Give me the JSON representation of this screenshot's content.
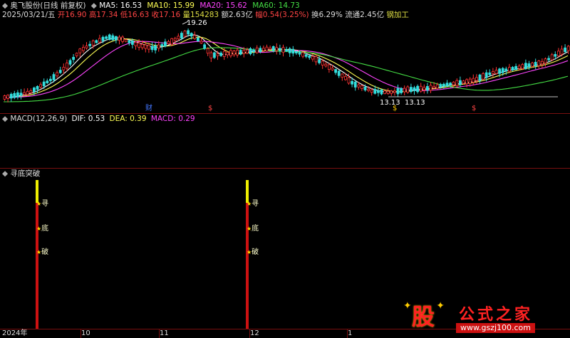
{
  "header": {
    "stock_name": "奥飞股份(日线 前复权)",
    "ma_labels": [
      {
        "label": "MA5: 16.53",
        "color": "#ffffff"
      },
      {
        "label": "MA10: 15.99",
        "color": "#ffff55"
      },
      {
        "label": "MA20: 15.62",
        "color": "#ff44ff"
      },
      {
        "label": "MA60: 14.73",
        "color": "#44dd44"
      }
    ]
  },
  "quote": {
    "date": "2025/03/21/五",
    "items": [
      {
        "label": "开16.90",
        "color": "#ff4444"
      },
      {
        "label": "高17.34",
        "color": "#ff4444"
      },
      {
        "label": "低16.63",
        "color": "#ff4444"
      },
      {
        "label": "收17.16",
        "color": "#ff4444"
      },
      {
        "label": "量154283",
        "color": "#dddd44"
      },
      {
        "label": "额2.63亿",
        "color": "#dddddd"
      },
      {
        "label": "幅0.54(3.25%)",
        "color": "#ff4444"
      },
      {
        "label": "换6.29%",
        "color": "#dddddd"
      },
      {
        "label": "流通2.45亿",
        "color": "#dddddd"
      },
      {
        "label": "钢加工",
        "color": "#dddd44"
      }
    ]
  },
  "price_annotations": {
    "high": "19.26",
    "low_left": "13.13",
    "low_right": "13.13"
  },
  "event_markers": [
    {
      "label": "财",
      "color": "#4477ff"
    },
    {
      "label": "$",
      "color": "#ff4444"
    },
    {
      "label": "$",
      "color": "#ffcc00"
    },
    {
      "label": "$",
      "color": "#ff4444"
    }
  ],
  "macd": {
    "title": "MACD(12,26,9)",
    "dif": "DIF: 0.53",
    "dea": "DEA: 0.39",
    "macd": "MACD: 0.29",
    "colors": {
      "dif": "#ffffff",
      "dea": "#ffff55",
      "macd": "#ff44ff"
    }
  },
  "indicator": {
    "title": "寻底突破",
    "signal_labels": [
      "寻",
      "底",
      "破"
    ]
  },
  "xaxis": {
    "labels": [
      "2024年",
      "10",
      "11",
      "12",
      "1"
    ]
  },
  "watermark": {
    "logo_char": "股",
    "site_name": "公式之家",
    "url": "www.gszj100.com"
  },
  "colors": {
    "up": "#ff3333",
    "down": "#33dddd",
    "separator": "#7a0f0f",
    "bar_red": "#cc1111",
    "bar_yellow": "#eeee00"
  }
}
